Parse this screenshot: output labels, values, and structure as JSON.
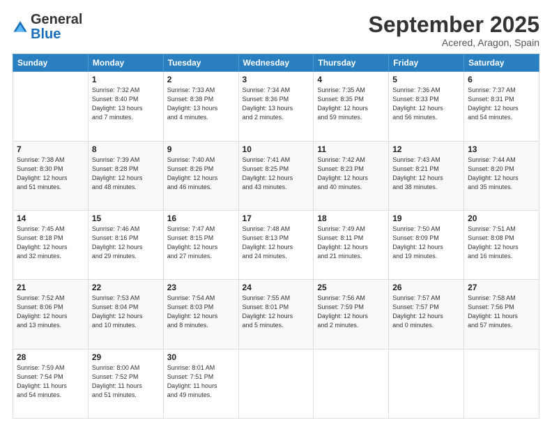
{
  "header": {
    "logo": {
      "general": "General",
      "blue": "Blue"
    },
    "month": "September 2025",
    "location": "Acered, Aragon, Spain"
  },
  "days_of_week": [
    "Sunday",
    "Monday",
    "Tuesday",
    "Wednesday",
    "Thursday",
    "Friday",
    "Saturday"
  ],
  "weeks": [
    [
      {
        "day": "",
        "info": ""
      },
      {
        "day": "1",
        "info": "Sunrise: 7:32 AM\nSunset: 8:40 PM\nDaylight: 13 hours\nand 7 minutes."
      },
      {
        "day": "2",
        "info": "Sunrise: 7:33 AM\nSunset: 8:38 PM\nDaylight: 13 hours\nand 4 minutes."
      },
      {
        "day": "3",
        "info": "Sunrise: 7:34 AM\nSunset: 8:36 PM\nDaylight: 13 hours\nand 2 minutes."
      },
      {
        "day": "4",
        "info": "Sunrise: 7:35 AM\nSunset: 8:35 PM\nDaylight: 12 hours\nand 59 minutes."
      },
      {
        "day": "5",
        "info": "Sunrise: 7:36 AM\nSunset: 8:33 PM\nDaylight: 12 hours\nand 56 minutes."
      },
      {
        "day": "6",
        "info": "Sunrise: 7:37 AM\nSunset: 8:31 PM\nDaylight: 12 hours\nand 54 minutes."
      }
    ],
    [
      {
        "day": "7",
        "info": "Sunrise: 7:38 AM\nSunset: 8:30 PM\nDaylight: 12 hours\nand 51 minutes."
      },
      {
        "day": "8",
        "info": "Sunrise: 7:39 AM\nSunset: 8:28 PM\nDaylight: 12 hours\nand 48 minutes."
      },
      {
        "day": "9",
        "info": "Sunrise: 7:40 AM\nSunset: 8:26 PM\nDaylight: 12 hours\nand 46 minutes."
      },
      {
        "day": "10",
        "info": "Sunrise: 7:41 AM\nSunset: 8:25 PM\nDaylight: 12 hours\nand 43 minutes."
      },
      {
        "day": "11",
        "info": "Sunrise: 7:42 AM\nSunset: 8:23 PM\nDaylight: 12 hours\nand 40 minutes."
      },
      {
        "day": "12",
        "info": "Sunrise: 7:43 AM\nSunset: 8:21 PM\nDaylight: 12 hours\nand 38 minutes."
      },
      {
        "day": "13",
        "info": "Sunrise: 7:44 AM\nSunset: 8:20 PM\nDaylight: 12 hours\nand 35 minutes."
      }
    ],
    [
      {
        "day": "14",
        "info": "Sunrise: 7:45 AM\nSunset: 8:18 PM\nDaylight: 12 hours\nand 32 minutes."
      },
      {
        "day": "15",
        "info": "Sunrise: 7:46 AM\nSunset: 8:16 PM\nDaylight: 12 hours\nand 29 minutes."
      },
      {
        "day": "16",
        "info": "Sunrise: 7:47 AM\nSunset: 8:15 PM\nDaylight: 12 hours\nand 27 minutes."
      },
      {
        "day": "17",
        "info": "Sunrise: 7:48 AM\nSunset: 8:13 PM\nDaylight: 12 hours\nand 24 minutes."
      },
      {
        "day": "18",
        "info": "Sunrise: 7:49 AM\nSunset: 8:11 PM\nDaylight: 12 hours\nand 21 minutes."
      },
      {
        "day": "19",
        "info": "Sunrise: 7:50 AM\nSunset: 8:09 PM\nDaylight: 12 hours\nand 19 minutes."
      },
      {
        "day": "20",
        "info": "Sunrise: 7:51 AM\nSunset: 8:08 PM\nDaylight: 12 hours\nand 16 minutes."
      }
    ],
    [
      {
        "day": "21",
        "info": "Sunrise: 7:52 AM\nSunset: 8:06 PM\nDaylight: 12 hours\nand 13 minutes."
      },
      {
        "day": "22",
        "info": "Sunrise: 7:53 AM\nSunset: 8:04 PM\nDaylight: 12 hours\nand 10 minutes."
      },
      {
        "day": "23",
        "info": "Sunrise: 7:54 AM\nSunset: 8:03 PM\nDaylight: 12 hours\nand 8 minutes."
      },
      {
        "day": "24",
        "info": "Sunrise: 7:55 AM\nSunset: 8:01 PM\nDaylight: 12 hours\nand 5 minutes."
      },
      {
        "day": "25",
        "info": "Sunrise: 7:56 AM\nSunset: 7:59 PM\nDaylight: 12 hours\nand 2 minutes."
      },
      {
        "day": "26",
        "info": "Sunrise: 7:57 AM\nSunset: 7:57 PM\nDaylight: 12 hours\nand 0 minutes."
      },
      {
        "day": "27",
        "info": "Sunrise: 7:58 AM\nSunset: 7:56 PM\nDaylight: 11 hours\nand 57 minutes."
      }
    ],
    [
      {
        "day": "28",
        "info": "Sunrise: 7:59 AM\nSunset: 7:54 PM\nDaylight: 11 hours\nand 54 minutes."
      },
      {
        "day": "29",
        "info": "Sunrise: 8:00 AM\nSunset: 7:52 PM\nDaylight: 11 hours\nand 51 minutes."
      },
      {
        "day": "30",
        "info": "Sunrise: 8:01 AM\nSunset: 7:51 PM\nDaylight: 11 hours\nand 49 minutes."
      },
      {
        "day": "",
        "info": ""
      },
      {
        "day": "",
        "info": ""
      },
      {
        "day": "",
        "info": ""
      },
      {
        "day": "",
        "info": ""
      }
    ]
  ]
}
